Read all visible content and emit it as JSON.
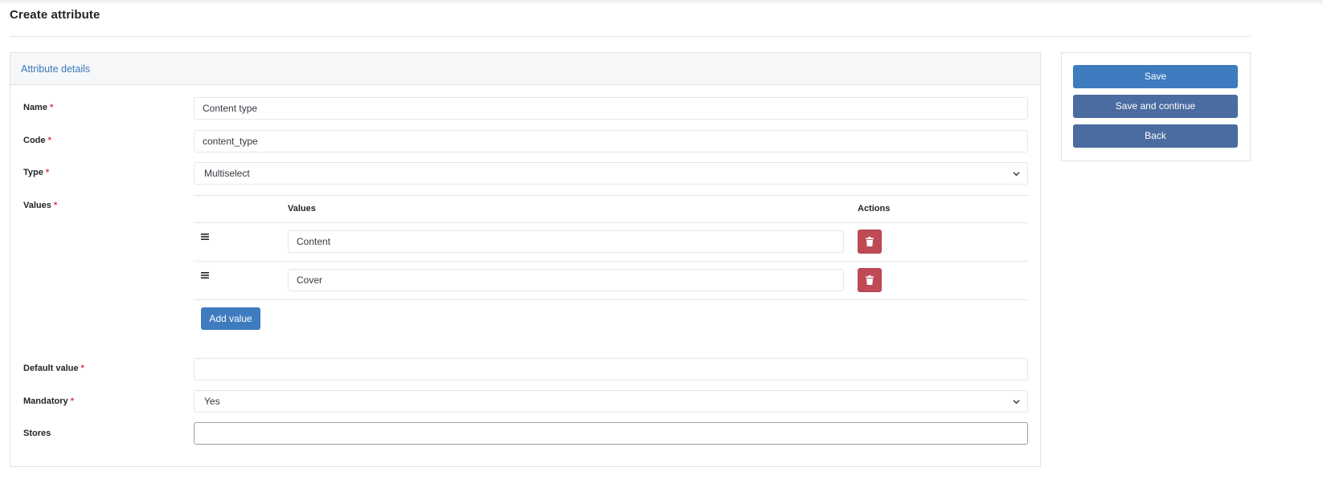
{
  "page": {
    "title": "Create attribute"
  },
  "card": {
    "header": "Attribute details"
  },
  "fields": {
    "name": {
      "label": "Name",
      "value": "Content type",
      "required": "*"
    },
    "code": {
      "label": "Code",
      "value": "content_type",
      "required": "*"
    },
    "type": {
      "label": "Type",
      "value": "Multiselect",
      "required": "*"
    },
    "values": {
      "label": "Values",
      "required": "*"
    },
    "default_value": {
      "label": "Default value",
      "value": "",
      "required": "*"
    },
    "mandatory": {
      "label": "Mandatory",
      "value": "Yes",
      "required": "*"
    },
    "stores": {
      "label": "Stores",
      "value": ""
    }
  },
  "values_table": {
    "headers": {
      "values": "Values",
      "actions": "Actions"
    },
    "rows": [
      {
        "value": "Content"
      },
      {
        "value": "Cover"
      }
    ],
    "add_label": "Add value"
  },
  "actions": {
    "save": "Save",
    "save_continue": "Save and continue",
    "back": "Back"
  },
  "icons": {
    "drag": "drag-handle-icon",
    "delete": "trash-icon",
    "dropdown": "chevron-down-icon"
  },
  "colors": {
    "primary": "#3f7bbf",
    "secondary": "#4b6ca1",
    "danger": "#bf4a55",
    "header_text": "#3a78b8",
    "required": "#dc3545"
  }
}
